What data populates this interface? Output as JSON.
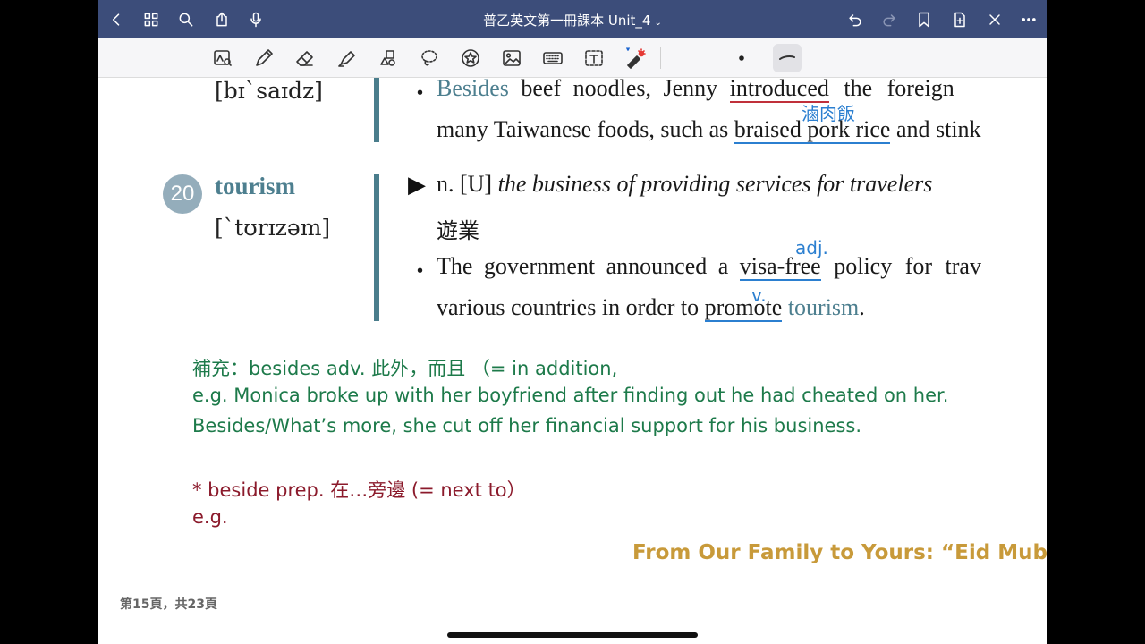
{
  "nav": {
    "title": "普乙英文第一冊課本 Unit_4",
    "title_chevron": "⌄"
  },
  "page_indicator": "第15頁，共23頁",
  "entry_prev": {
    "phonetic": "[bɪ`saɪdz]",
    "example_line1": {
      "word": "Besides",
      "p1": " beef noodles, Jenny ",
      "underlined": "introduced",
      "p2": " the foreign "
    },
    "example_line2": {
      "p1": "many Taiwanese foods, such as ",
      "underlined": "braised pork rice",
      "p2": " and stink"
    },
    "annotation": "滷肉飯"
  },
  "entry": {
    "number": "20",
    "word": "tourism",
    "phonetic": "[`tʊrɪzəm]",
    "def_line1": {
      "pos": "n. [U] ",
      "definition": "the business of providing services for travelers"
    },
    "def_line2": "遊業",
    "example_line1": {
      "p1": "The government announced a ",
      "underlined": "visa-free",
      "p2": " policy for trav"
    },
    "example_line2": {
      "p1": "various countries in order to ",
      "underlined": "promote",
      "word": "tourism",
      "p2": "."
    },
    "annotation_adj": "adj.",
    "annotation_v": "v."
  },
  "notes": {
    "line1": "補充：besides  adv. 此外，而且  （= in addition,",
    "line2": "e.g. Monica broke up with her boyfriend after finding out he had cheated on her.",
    "line3": "Besides/What’s more, she cut off her financial support for his business.",
    "line4": "* beside prep. 在…旁邊  (= next to）",
    "line5": "e.g."
  },
  "banner": "From Our Family to Yours: “Eid Mub",
  "colors": {
    "navbar": "#3c4d7a",
    "teal": "#4d7f8f",
    "note_green": "#1d7a4a",
    "note_red": "#8b1a2b",
    "annotation_blue": "#2b7fd0",
    "banner_gold": "#c89a3a"
  }
}
